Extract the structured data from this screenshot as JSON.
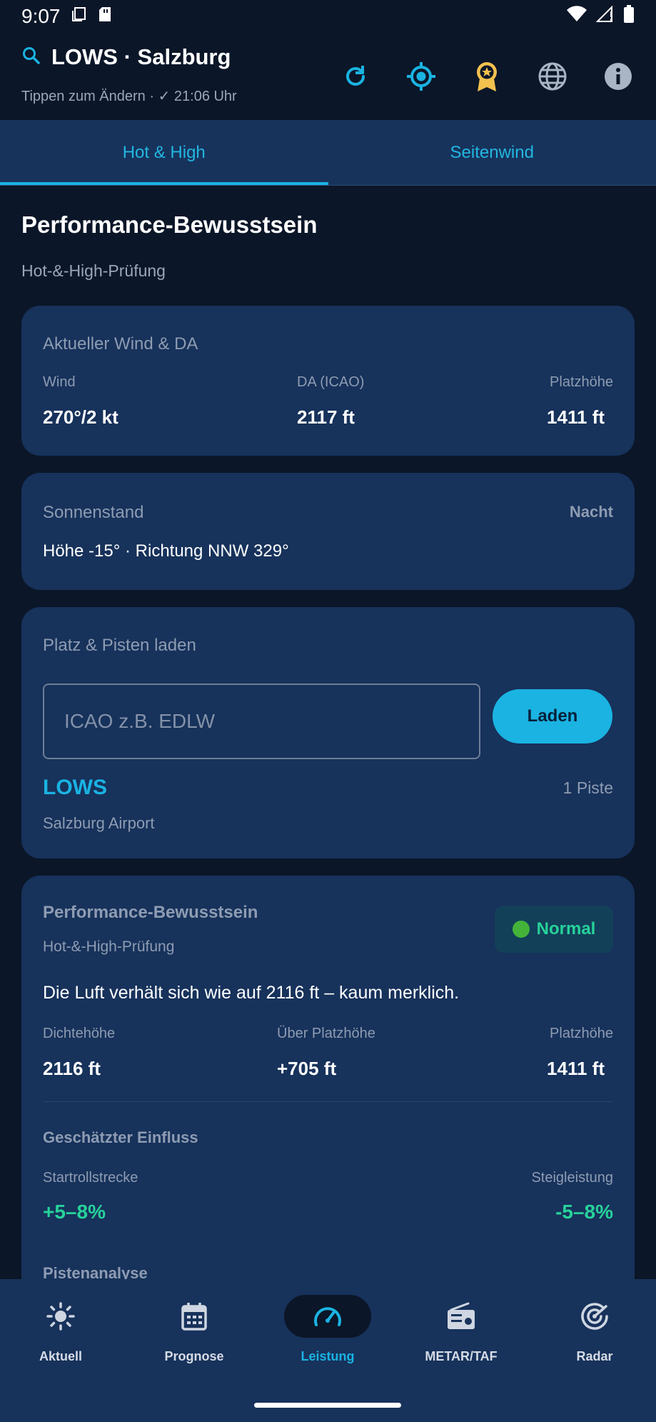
{
  "status_bar": {
    "time": "9:07"
  },
  "header": {
    "station": "LOWS · Salzburg",
    "subtitle": "Tippen zum Ändern · ✓ 21:06 Uhr"
  },
  "tabs": [
    {
      "label": "Hot & High",
      "active": true
    },
    {
      "label": "Seitenwind",
      "active": false
    }
  ],
  "page": {
    "title": "Performance-Bewusstsein",
    "subtitle": "Hot-&-High-Prüfung"
  },
  "wind_card": {
    "title": "Aktueller Wind & DA",
    "wind_label": "Wind",
    "wind_value": "270°/2 kt",
    "da_label": "DA (ICAO)",
    "da_value": "2117 ft",
    "elev_label": "Platzhöhe",
    "elev_value": "1411 ft"
  },
  "sun_card": {
    "title": "Sonnenstand",
    "status": "Nacht",
    "detail": "Höhe -15° · Richtung NNW 329°"
  },
  "load_card": {
    "title": "Platz & Pisten laden",
    "input_placeholder": "ICAO z.B. EDLW",
    "input_value": "",
    "button_label": "Laden",
    "airport_code": "LOWS",
    "runway_count": "1 Piste",
    "airport_name": "Salzburg Airport"
  },
  "perf_card": {
    "title": "Performance-Bewusstsein",
    "subtitle": "Hot-&-High-Prüfung",
    "badge": "Normal",
    "description": "Die Luft verhält sich wie auf 2116 ft – kaum merklich.",
    "da_label": "Dichtehöhe",
    "da_value": "2116 ft",
    "above_label": "Über Platzhöhe",
    "above_value": "+705 ft",
    "elev_label": "Platzhöhe",
    "elev_value": "1411 ft",
    "impact_title": "Geschätzter Einfluss",
    "takeoff_label": "Startrollstrecke",
    "takeoff_value": "+5–8%",
    "climb_label": "Steigleistung",
    "climb_value": "-5–8%",
    "runway_title": "Pistenanalyse"
  },
  "bottom_nav": [
    {
      "label": "Aktuell",
      "icon": "sun-icon",
      "active": false
    },
    {
      "label": "Prognose",
      "icon": "calendar-icon",
      "active": false
    },
    {
      "label": "Leistung",
      "icon": "speedometer-icon",
      "active": true
    },
    {
      "label": "METAR/TAF",
      "icon": "radio-icon",
      "active": false
    },
    {
      "label": "Radar",
      "icon": "radar-icon",
      "active": false
    }
  ],
  "colors": {
    "background": "#0b1628",
    "card": "#17325b",
    "accent": "#1ab3e2",
    "positive": "#27d29a",
    "muted": "#8e9cb2",
    "gold": "#f2c14e"
  }
}
